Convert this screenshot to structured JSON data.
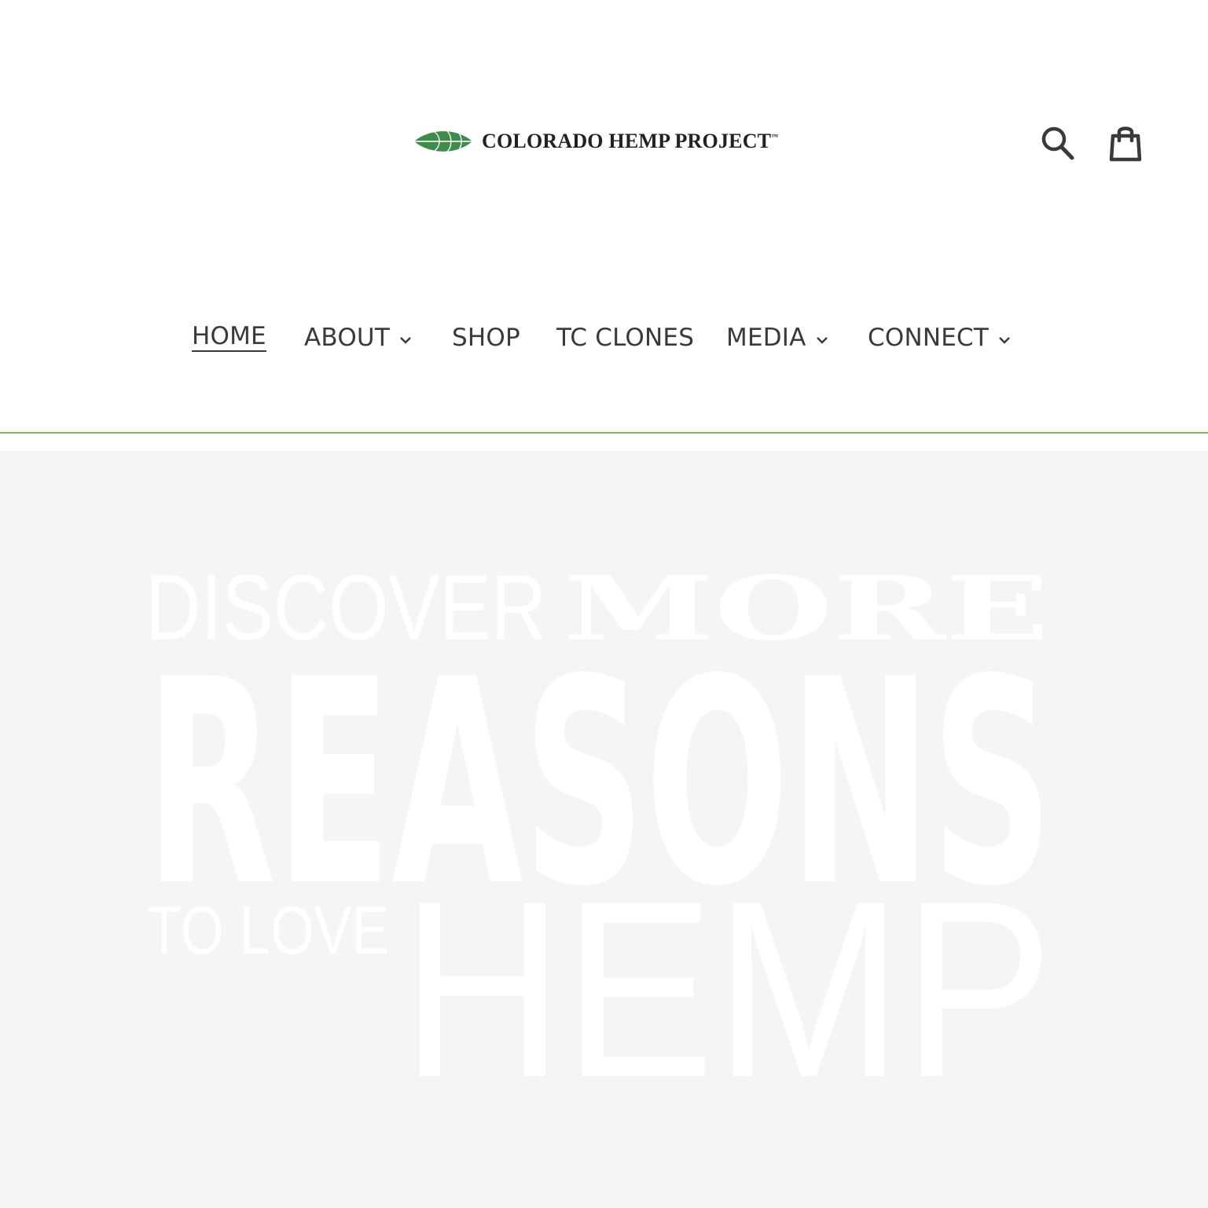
{
  "header": {
    "logo": {
      "text": "COLORADO HEMP PROJECT",
      "trademark": "™",
      "leaf_color": "#3f8b4b"
    },
    "icons": {
      "search": "search-icon",
      "cart": "shopping-bag-icon"
    }
  },
  "nav": {
    "items": [
      {
        "label": "HOME",
        "active": true,
        "dropdown": false
      },
      {
        "label": "ABOUT",
        "active": false,
        "dropdown": true
      },
      {
        "label": "SHOP",
        "active": false,
        "dropdown": false
      },
      {
        "label": "TC CLONES",
        "active": false,
        "dropdown": false
      },
      {
        "label": "MEDIA",
        "active": false,
        "dropdown": true
      },
      {
        "label": "CONNECT",
        "active": false,
        "dropdown": true
      }
    ],
    "accent_rule_color": "#7ab55c"
  },
  "hero": {
    "background_color": "#f5f5f5",
    "line1_light": "DISCOVER",
    "line1_bold": "MORE",
    "line2": "REASONS",
    "line3_small": "TO LOVE",
    "line3_large": "HEMP"
  }
}
